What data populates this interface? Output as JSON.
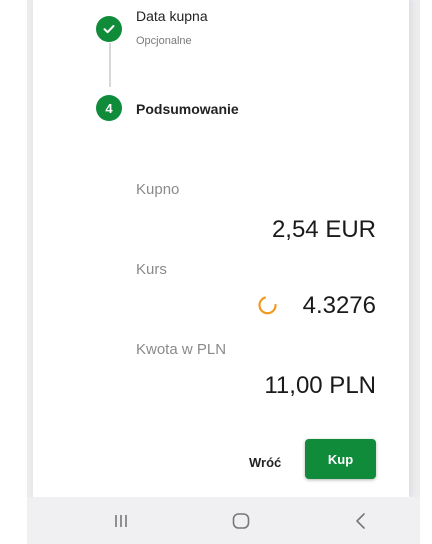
{
  "steps": [
    {
      "title": "Data kupna",
      "subtitle": "Opcjonalne",
      "icon": "check-icon",
      "status": "completed"
    },
    {
      "number": "4",
      "title": "Podsumowanie",
      "status": "active"
    }
  ],
  "summary": {
    "buy_label": "Kupno",
    "buy_value": "2,54 EUR",
    "rate_label": "Kurs",
    "rate_value": "4.3276",
    "amount_label": "Kwota w PLN",
    "amount_value": "11,00 PLN"
  },
  "actions": {
    "back_label": "Wróć",
    "buy_label": "Kup"
  },
  "navbar": {
    "icons": [
      "recent-apps-icon",
      "home-icon",
      "back-icon"
    ]
  },
  "colors": {
    "brand_green": "#0f8b3a",
    "spinner_orange": "#f39a1e",
    "label_gray": "#8a8a8a"
  }
}
